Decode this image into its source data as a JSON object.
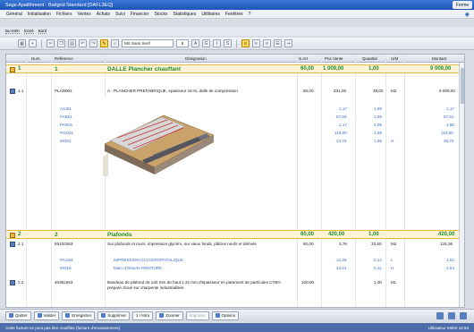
{
  "window": {
    "title": "Sage Apalithment · Batigrid Standard [DAFL3EQ]",
    "corner_label": "Ferme"
  },
  "menu": [
    "Général",
    "Initialisation",
    "Fichiers",
    "Ventes",
    "Achats",
    "Suivi",
    "Financier",
    "Stocks",
    "Statistiques",
    "Utilitaires",
    "Fenêtres",
    "?"
  ],
  "tabs": [
    "Bu-Métr",
    "Entré",
    "Bard"
  ],
  "toolbar": {
    "font": "MS Sans Serif",
    "size": "8"
  },
  "columns": {
    "num": "Num.",
    "ref": "Référence",
    "designation": "Désignation",
    "debut": "S.Art",
    "pv": "Prix Vente",
    "qte": "Quantité",
    "unit": "U/M",
    "montant": "Montant"
  },
  "rows": [
    {
      "num": "1",
      "ref": "1",
      "designation": "DALLE Plancher chauffant",
      "debut": "60,00",
      "pv": "1 009,00",
      "qte": "1,00",
      "unit": "",
      "montant": "9 009,00"
    },
    {
      "num": "1.1",
      "ref": "PLAN001",
      "designation": "A - PLANCHER PREFABRIQUE, epaisseur 16+5, dalle de compression",
      "debut": "60,00",
      "pv": "231,00",
      "qte": "39,00",
      "unit": "M2",
      "montant": "9 009,00"
    },
    {
      "num": "",
      "ref": "ACI01",
      "designation": "Acier ia",
      "debut": "",
      "pv": "1,17",
      "qte": "1,89",
      "unit": "",
      "montant": "1,17"
    },
    {
      "num": "",
      "ref": "FAB01",
      "designation": "Fab controle Beton gravill. dose 250 kg",
      "debut": "",
      "pv": "87,66",
      "qte": "1,89",
      "unit": "",
      "montant": "57,62"
    },
    {
      "num": "",
      "ref": "PAR01",
      "designation": "Pinpeng plan 20x50 ep 12,5",
      "debut": "",
      "pv": "1,17",
      "qte": "4,09",
      "unit": "",
      "montant": "4,80"
    },
    {
      "num": "",
      "ref": "POU01",
      "designation": "POUTRELLE BETON",
      "debut": "",
      "pv": "116,00",
      "qte": "1,89",
      "unit": "",
      "montant": "116,60"
    },
    {
      "num": "",
      "ref": "MO01",
      "designation": "Main d'Oeuvre GROS-OEUVRE - MACONNERIE",
      "debut": "",
      "pv": "23,76",
      "qte": "1,89",
      "unit": "H",
      "montant": "26,75"
    },
    {
      "num": "2",
      "ref": "2",
      "designation": "Plafonds",
      "debut": "60,00",
      "pv": "420,00",
      "qte": "1,00",
      "unit": "",
      "montant": "420,00"
    },
    {
      "num": "2.1",
      "ref": "66100363",
      "designation": "Sur plafonds et murs, impression glycéro, sur vieux fonds, plâtres neufs et dérivés",
      "debut": "60,00",
      "pv": "3,76",
      "qte": "33,60",
      "unit": "M2",
      "montant": "126,36"
    },
    {
      "num": "",
      "ref": "PA1M4",
      "designation": "IMPRESSION GLYCEROPHTALIQUE",
      "debut": "",
      "pv": "12,26",
      "qte": "0,14",
      "unit": "L",
      "montant": "1,52"
    },
    {
      "num": "",
      "ref": "MO16",
      "designation": "Main d'Oeuvre PEINTURE",
      "debut": "",
      "pv": "24,01",
      "qte": "0,11",
      "unit": "H",
      "montant": "2,64"
    },
    {
      "num": "2.2",
      "ref": "40361563",
      "designation": "Bandeau de plafond de 140 mm de haut x 22 mm d'épaisseur en parement de particules CTBH préparé cloué sur charpente industrialisée",
      "debut": "100,00",
      "pv": "",
      "qte": "1,00",
      "unit": "ML",
      "montant": ""
    }
  ],
  "bottom_buttons": [
    "Quitter",
    "Valider",
    "Enregistrer",
    "Supprimer",
    "1 / Intro",
    "Zoomer",
    "Imprimer",
    "Options"
  ],
  "status": {
    "left": "Cette facture ne peut pas être modifiée (facture d'encaissement)",
    "right": "Utilisateur Métré    16:53"
  },
  "colors": {
    "title_green": "#1f8a2b",
    "sub_blue": "#3a6fc9",
    "sub_red": "#d12a1e",
    "titlebar": "#2a5fc4"
  }
}
